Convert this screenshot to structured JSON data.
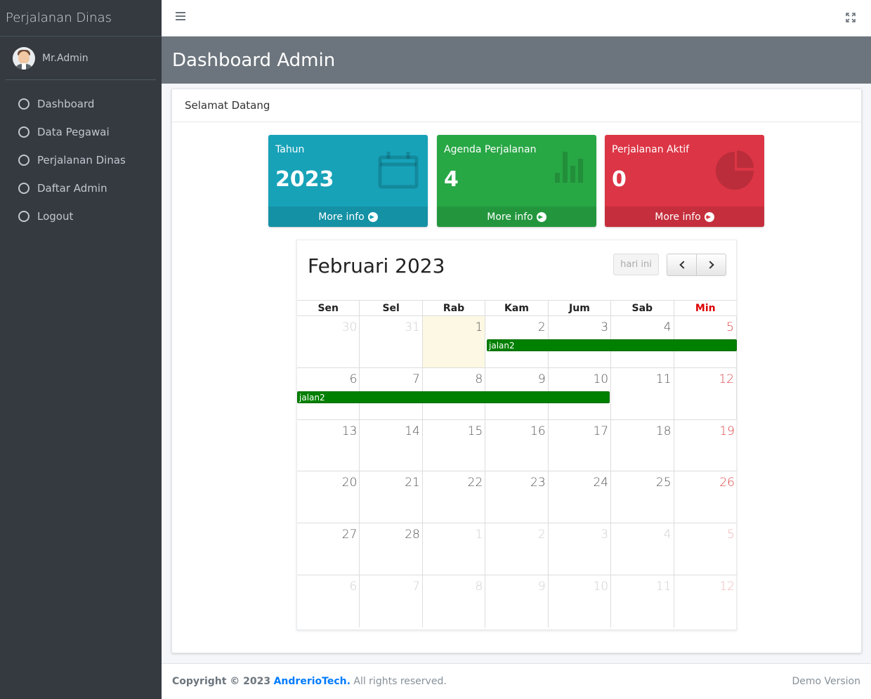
{
  "sidebar": {
    "brand": "Perjalanan Dinas",
    "user_name": "Mr.Admin",
    "items": [
      {
        "label": "Dashboard"
      },
      {
        "label": "Data Pegawai"
      },
      {
        "label": "Perjalanan Dinas"
      },
      {
        "label": "Daftar Admin"
      },
      {
        "label": "Logout"
      }
    ]
  },
  "header": {
    "title": "Dashboard Admin"
  },
  "card": {
    "title": "Selamat Datang"
  },
  "stats": [
    {
      "label": "Tahun",
      "value": "2023",
      "footer": "More info",
      "icon": "calendar-icon",
      "color": "#17a2b8"
    },
    {
      "label": "Agenda Perjalanan",
      "value": "4",
      "footer": "More info",
      "icon": "bar-chart-icon",
      "color": "#28a745"
    },
    {
      "label": "Perjalanan Aktif",
      "value": "0",
      "footer": "More info",
      "icon": "pie-chart-icon",
      "color": "#dc3545"
    }
  ],
  "calendar": {
    "title": "Februari 2023",
    "today_button": "hari ini",
    "days_of_week": [
      "Sen",
      "Sel",
      "Rab",
      "Kam",
      "Jum",
      "Sab",
      "Min"
    ],
    "weeks": [
      [
        "30",
        "31",
        "1",
        "2",
        "3",
        "4",
        "5"
      ],
      [
        "6",
        "7",
        "8",
        "9",
        "10",
        "11",
        "12"
      ],
      [
        "13",
        "14",
        "15",
        "16",
        "17",
        "18",
        "19"
      ],
      [
        "20",
        "21",
        "22",
        "23",
        "24",
        "25",
        "26"
      ],
      [
        "27",
        "28",
        "1",
        "2",
        "3",
        "4",
        "5"
      ],
      [
        "6",
        "7",
        "8",
        "9",
        "10",
        "11",
        "12"
      ]
    ],
    "events": [
      {
        "title": "jalan2",
        "color": "#008000"
      },
      {
        "title": "jalan2",
        "color": "#008000"
      }
    ]
  },
  "footer": {
    "copyright": "Copyright © 2023",
    "company": "AndrerioTech.",
    "rights": "All rights reserved.",
    "version": "Demo Version"
  }
}
